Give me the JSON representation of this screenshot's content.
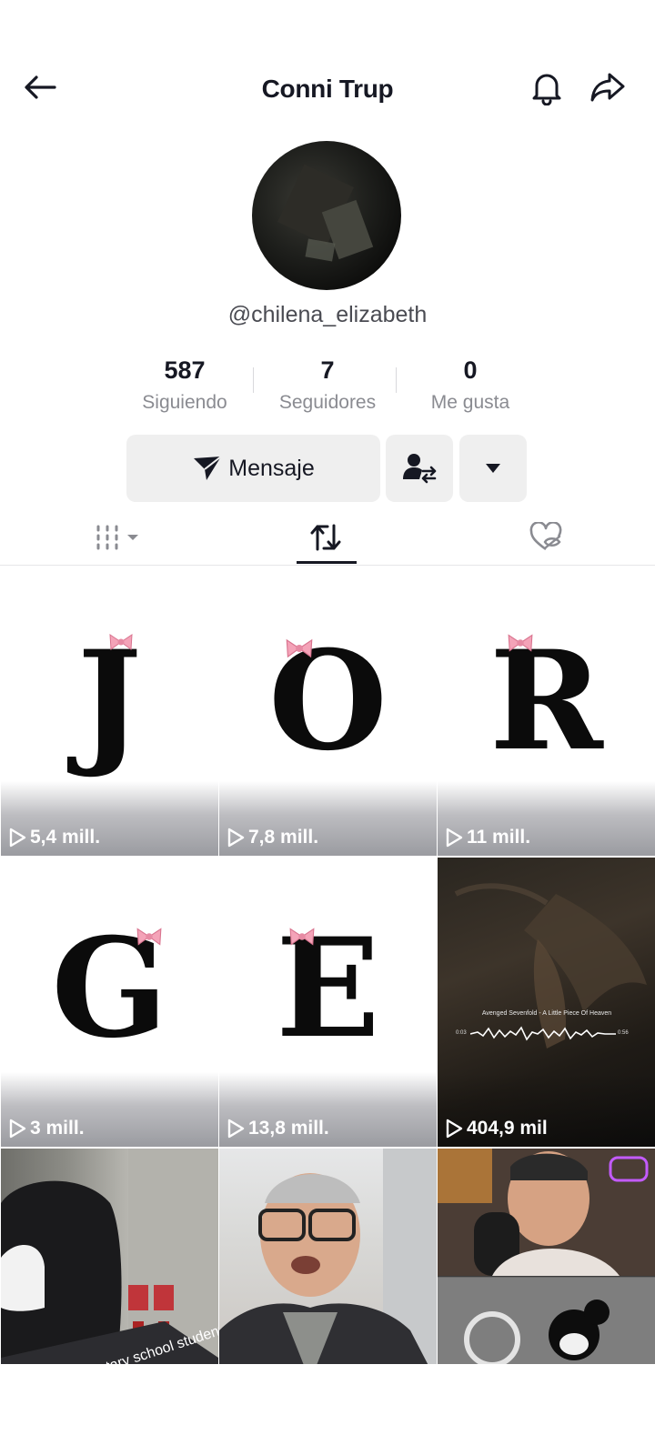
{
  "header": {
    "title": "Conni Trup"
  },
  "profile": {
    "username": "@chilena_elizabeth"
  },
  "stats": [
    {
      "value": "587",
      "label": "Siguiendo"
    },
    {
      "value": "7",
      "label": "Seguidores"
    },
    {
      "value": "0",
      "label": "Me gusta"
    }
  ],
  "actions": {
    "message_label": "Mensaje"
  },
  "videos": [
    {
      "letter": "J",
      "views": "5,4 mill."
    },
    {
      "letter": "O",
      "views": "7,8 mill."
    },
    {
      "letter": "R",
      "views": "11 mill."
    },
    {
      "letter": "G",
      "views": "3 mill."
    },
    {
      "letter": "E",
      "views": "13,8 mill."
    },
    {
      "views": "404,9 mil",
      "overlay_title": "Avenged Sevenfold - A Little Piece Of Heaven",
      "time_start": "0:03",
      "time_end": "0:56"
    },
    {
      "overlay_text": "Elementary school student"
    },
    {},
    {}
  ],
  "colors": {
    "bow": "#f4a3b8",
    "text": "#161823",
    "secondary": "#8a8b91",
    "button_bg": "#efefef"
  }
}
